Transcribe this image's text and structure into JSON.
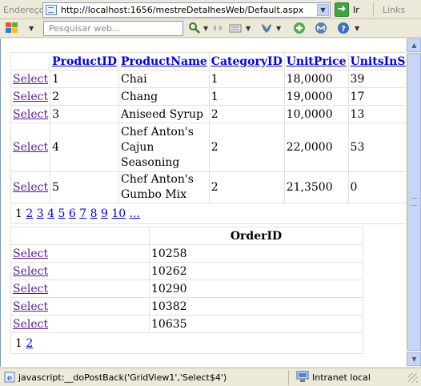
{
  "addressbar": {
    "label": "Endereço",
    "url": "http://localhost:1656/mestreDetalhesWeb/Default.aspx",
    "go_label": "Ir",
    "links_label": "Links"
  },
  "toolbar": {
    "search_placeholder": "Pesquisar web..."
  },
  "products": {
    "columns": [
      "ProductID",
      "ProductName",
      "CategoryID",
      "UnitPrice",
      "UnitsInStock"
    ],
    "select_label": "Select",
    "rows": [
      {
        "id": "1",
        "name": "Chai",
        "category": "1",
        "price": "18,0000",
        "stock": "39"
      },
      {
        "id": "2",
        "name": "Chang",
        "category": "1",
        "price": "19,0000",
        "stock": "17"
      },
      {
        "id": "3",
        "name": "Aniseed Syrup",
        "category": "2",
        "price": "10,0000",
        "stock": "13"
      },
      {
        "id": "4",
        "name": "Chef Anton's Cajun Seasoning",
        "category": "2",
        "price": "22,0000",
        "stock": "53"
      },
      {
        "id": "5",
        "name": "Chef Anton's Gumbo Mix",
        "category": "2",
        "price": "21,3500",
        "stock": "0"
      }
    ],
    "pager": {
      "current": "1",
      "pages": [
        "2",
        "3",
        "4",
        "5",
        "6",
        "7",
        "8",
        "9",
        "10",
        "..."
      ]
    }
  },
  "orders": {
    "column": "OrderID",
    "select_label": "Select",
    "rows": [
      "10258",
      "10262",
      "10290",
      "10382",
      "10635"
    ],
    "pager": {
      "current": "1",
      "pages": [
        "2"
      ]
    }
  },
  "statusbar": {
    "text": "javascript:__doPostBack('GridView1','Select$4')",
    "zone": "Intranet local"
  },
  "colors": {
    "window_bg": "#ece9d8",
    "link_visited": "#5a1896",
    "link": "#0000ee"
  }
}
